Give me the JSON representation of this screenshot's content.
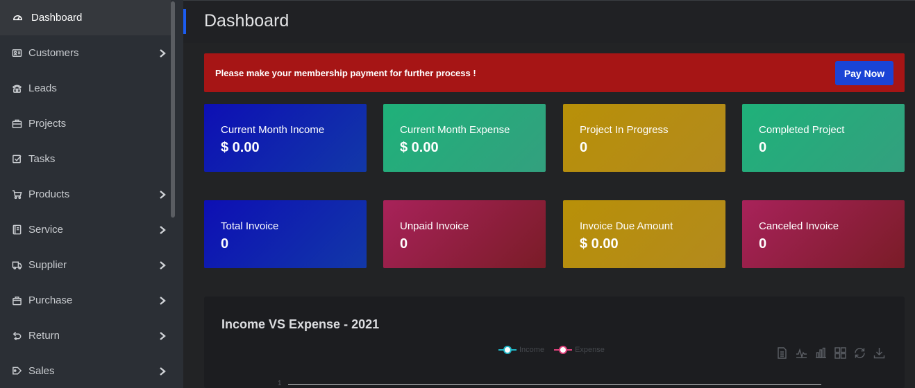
{
  "sidebar": {
    "items": [
      {
        "label": "Dashboard",
        "icon": "dashboard-icon",
        "active": true,
        "has_submenu": false
      },
      {
        "label": "Customers",
        "icon": "id-card-icon",
        "active": false,
        "has_submenu": true
      },
      {
        "label": "Leads",
        "icon": "phone-icon",
        "active": false,
        "has_submenu": false
      },
      {
        "label": "Projects",
        "icon": "briefcase-icon",
        "active": false,
        "has_submenu": false
      },
      {
        "label": "Tasks",
        "icon": "checkbox-icon",
        "active": false,
        "has_submenu": false
      },
      {
        "label": "Products",
        "icon": "cart-icon",
        "active": false,
        "has_submenu": true
      },
      {
        "label": "Service",
        "icon": "book-icon",
        "active": false,
        "has_submenu": true
      },
      {
        "label": "Supplier",
        "icon": "truck-icon",
        "active": false,
        "has_submenu": true
      },
      {
        "label": "Purchase",
        "icon": "bag-icon",
        "active": false,
        "has_submenu": true
      },
      {
        "label": "Return",
        "icon": "return-icon",
        "active": false,
        "has_submenu": true
      },
      {
        "label": "Sales",
        "icon": "sales-icon",
        "active": false,
        "has_submenu": true
      }
    ]
  },
  "header": {
    "title": "Dashboard"
  },
  "alert": {
    "message": "Please make your membership payment for further process !",
    "button_label": "Pay Now"
  },
  "stats": {
    "row1": [
      {
        "label": "Current Month Income",
        "value": "$ 0.00",
        "color": "#0d0fb4"
      },
      {
        "label": "Current Month Expense",
        "value": "$ 0.00",
        "color": "#1fb17a"
      },
      {
        "label": "Project In Progress",
        "value": "0",
        "color": "#b89008"
      },
      {
        "label": "Completed Project",
        "value": "0",
        "color": "#1fb17a"
      }
    ],
    "row2": [
      {
        "label": "Total Invoice",
        "value": "0",
        "color": "#0d0fb4"
      },
      {
        "label": "Unpaid Invoice",
        "value": "0",
        "color": "#a8225a"
      },
      {
        "label": "Invoice Due Amount",
        "value": "$ 0.00",
        "color": "#b89008"
      },
      {
        "label": "Canceled Invoice",
        "value": "0",
        "color": "#a8225a"
      }
    ]
  },
  "chart_panel": {
    "title": "Income VS Expense - 2021",
    "legend": [
      {
        "name": "Income",
        "color": "#1fb7c8"
      },
      {
        "name": "Expense",
        "color": "#e0417c"
      }
    ],
    "tools": [
      "data-view-icon",
      "line-chart-icon",
      "bar-chart-icon",
      "stack-icon",
      "restore-icon",
      "download-icon"
    ],
    "axis_tick": "1"
  },
  "colors": {
    "accent": "#1b5cf0",
    "alert": "#a61515",
    "sidebar": "#2b2f35"
  }
}
